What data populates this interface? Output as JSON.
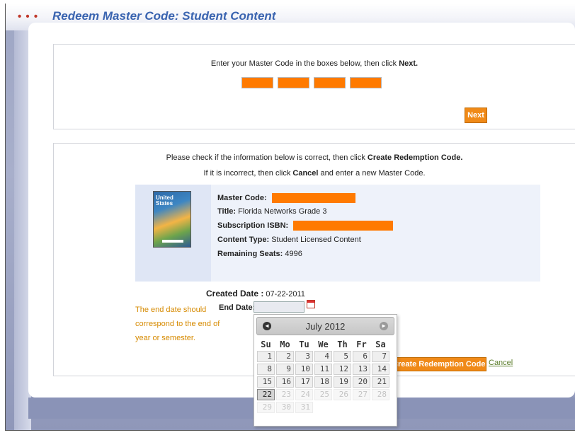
{
  "window": {
    "title": "Redeem Master Code: Student Content",
    "title_dots": "• • •"
  },
  "code_step": {
    "instruction_prefix": "Enter your Master Code in the boxes below, then click ",
    "instruction_bold": "Next.",
    "inputs": [
      "",
      "",
      "",
      ""
    ],
    "next_label": "Next"
  },
  "confirm_step": {
    "line1_prefix": "Please check if the information below is correct, then click ",
    "line1_bold": "Create Redemption Code.",
    "line2_prefix": "If it is incorrect, then click ",
    "line2_bold": "Cancel",
    "line2_suffix": " and enter a new Master Code.",
    "cover_text": "United States",
    "info": {
      "master_code_label": "Master Code:",
      "title_label": "Title:",
      "title_value": "Florida Networks Grade 3",
      "isbn_label": "Subscription ISBN:",
      "content_type_label": "Content Type:",
      "content_type_value": "Student Licensed Content",
      "seats_label": "Remaining Seats:",
      "seats_value": "4996"
    },
    "created_label": "Created Date :",
    "created_value": "07-22-2011",
    "help_note": "The end date should correspond to the end of year or semester.",
    "end_label": "End Date:",
    "end_value": "",
    "create_label": "Create Redemption Code",
    "cancel_label": "Cancel"
  },
  "datepicker": {
    "month_title": "July 2012",
    "prev_icon": "◀",
    "next_icon": "▶",
    "dow": [
      "Su",
      "Mo",
      "Tu",
      "We",
      "Th",
      "Fr",
      "Sa"
    ],
    "weeks": [
      [
        "1",
        "2",
        "3",
        "4",
        "5",
        "6",
        "7"
      ],
      [
        "8",
        "9",
        "10",
        "11",
        "12",
        "13",
        "14"
      ],
      [
        "15",
        "16",
        "17",
        "18",
        "19",
        "20",
        "21"
      ],
      [
        "22",
        "23",
        "24",
        "25",
        "26",
        "27",
        "28"
      ],
      [
        "29",
        "30",
        "31",
        "",
        "",
        "",
        ""
      ]
    ],
    "selected": "22",
    "first_disabled": 23
  }
}
